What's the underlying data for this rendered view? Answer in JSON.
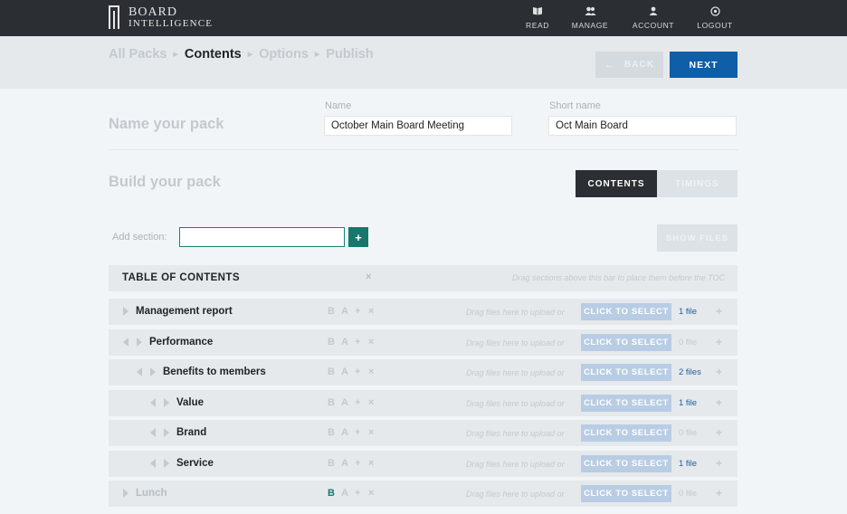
{
  "brand": {
    "line1": "BOARD",
    "line2": "INTELLIGENCE"
  },
  "nav": [
    {
      "label": "READ",
      "icon": "book-icon"
    },
    {
      "label": "MANAGE",
      "icon": "users-icon"
    },
    {
      "label": "ACCOUNT",
      "icon": "user-icon"
    },
    {
      "label": "LOGOUT",
      "icon": "power-icon"
    }
  ],
  "steps": [
    {
      "label": "All Packs",
      "active": false
    },
    {
      "label": "Contents",
      "active": true
    },
    {
      "label": "Options",
      "active": false
    },
    {
      "label": "Publish",
      "active": false
    }
  ],
  "buttons": {
    "back": "BACK",
    "next": "NEXT"
  },
  "name_section": {
    "heading": "Name your pack",
    "name_label": "Name",
    "name_value": "October Main Board Meeting",
    "short_label": "Short name",
    "short_value": "Oct Main Board"
  },
  "build_section": {
    "heading": "Build your pack",
    "tab_contents": "CONTENTS",
    "tab_timings": "TIMINGS",
    "add_label": "Add section:",
    "add_value": "",
    "add_button": "+",
    "show_files": "SHOW FILES"
  },
  "toc": {
    "title": "TABLE OF CONTENTS",
    "remove": "×",
    "hint": "Drag sections above this bar to place them before the TOC"
  },
  "row_labels": {
    "b": "B",
    "a": "A",
    "add": "+",
    "remove": "×",
    "drag_hint": "Drag files here to upload or",
    "select": "CLICK TO SELECT",
    "add_file": "+"
  },
  "rows": [
    {
      "title": "Management report",
      "level": 0,
      "files": "1 file",
      "dimmed": false,
      "b_active": false
    },
    {
      "title": "Performance",
      "level": 1,
      "files": "0 file",
      "dimmed": false,
      "b_active": false
    },
    {
      "title": "Benefits to members",
      "level": 2,
      "files": "2 files",
      "dimmed": false,
      "b_active": false
    },
    {
      "title": "Value",
      "level": 3,
      "files": "1 file",
      "dimmed": false,
      "b_active": false
    },
    {
      "title": "Brand",
      "level": 3,
      "files": "0 file",
      "dimmed": false,
      "b_active": false
    },
    {
      "title": "Service",
      "level": 3,
      "files": "1 file",
      "dimmed": false,
      "b_active": false
    },
    {
      "title": "Lunch",
      "level": 0,
      "files": "0 file",
      "dimmed": true,
      "b_active": true
    }
  ],
  "colors": {
    "accent": "#0e5ea8",
    "teal": "#16786c",
    "topbar": "#2b2f33"
  }
}
